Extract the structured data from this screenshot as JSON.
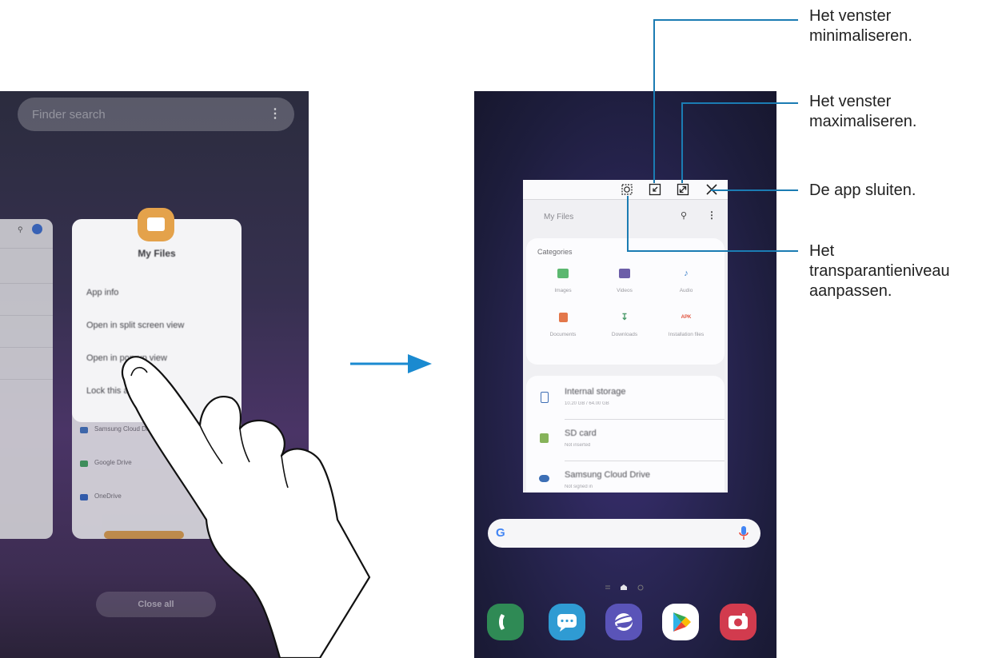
{
  "left_screen": {
    "finder_placeholder": "Finder search",
    "finder_menu_icon": "more-vertical-icon",
    "context_menu": {
      "app_title": "My Files",
      "items": [
        "App info",
        "Open in split screen view",
        "Open in pop-up view",
        "Lock this app"
      ]
    },
    "background_rows": [
      "Samsung Cloud Drive",
      "Google Drive",
      "OneDrive"
    ],
    "close_all_label": "Close all"
  },
  "right_screen": {
    "popup": {
      "app_title": "My Files",
      "controls": [
        "transparency-icon",
        "minimize-icon",
        "maximize-icon",
        "close-icon"
      ],
      "categories_title": "Categories",
      "categories": [
        "Images",
        "Videos",
        "Audio",
        "Documents",
        "Downloads",
        "Installation files"
      ],
      "storage": [
        {
          "name": "Internal storage",
          "detail": "10.20 GB / 64.00 GB"
        },
        {
          "name": "SD card",
          "detail": "Not inserted"
        },
        {
          "name": "Samsung Cloud Drive",
          "detail": "Not signed in"
        }
      ]
    },
    "google_bar": {
      "logo": "G",
      "mic_icon": "microphone-icon"
    },
    "dock": [
      "phone-icon",
      "messages-icon",
      "internet-icon",
      "play-store-icon",
      "camera-icon"
    ]
  },
  "callouts": {
    "minimize": [
      "Het venster",
      "minimaliseren."
    ],
    "maximize": [
      "Het venster",
      "maximaliseren."
    ],
    "close": [
      "De app sluiten."
    ],
    "transparency": [
      "Het",
      "transparantieniveau",
      "aanpassen."
    ]
  },
  "colors": {
    "callout_line": "#1b7cb3",
    "arrow": "#1a8ad0",
    "app_icon": "#e4a24b"
  }
}
